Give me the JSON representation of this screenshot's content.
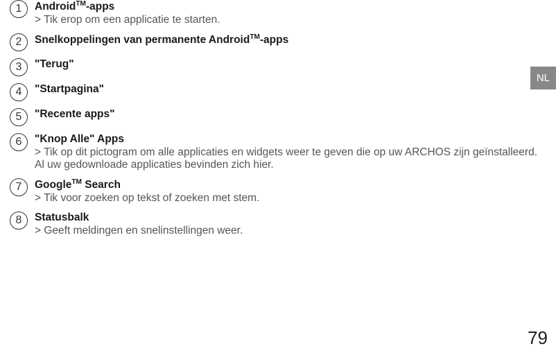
{
  "lang_tab": "NL",
  "page_number": "79",
  "items": [
    {
      "num": "1",
      "title_pre": "Android",
      "title_sup": "TM",
      "title_post": "-apps",
      "desc": "> Tik erop om een applicatie te starten."
    },
    {
      "num": "2",
      "title_pre": "Snelkoppelingen van permanente Android",
      "title_sup": "TM",
      "title_post": "-apps",
      "desc": ""
    },
    {
      "num": "3",
      "title_pre": "\"Terug\"",
      "title_sup": "",
      "title_post": "",
      "desc": ""
    },
    {
      "num": "4",
      "title_pre": "\"Startpagina\"",
      "title_sup": "",
      "title_post": "",
      "desc": ""
    },
    {
      "num": "5",
      "title_pre": "\"Recente apps\"",
      "title_sup": "",
      "title_post": "",
      "desc": ""
    },
    {
      "num": "6",
      "title_pre": "\"Knop Alle\" Apps",
      "title_sup": "",
      "title_post": "",
      "desc": "> Tik op dit pictogram om alle applicaties en widgets weer te geven die op uw ARCHOS zijn geïnstalleerd. Al uw gedownloade applicaties bevinden zich hier."
    },
    {
      "num": "7",
      "title_pre": "Google",
      "title_sup": "TM",
      "title_post": " Search",
      "desc": "> Tik voor zoeken op tekst of zoeken met stem."
    },
    {
      "num": "8",
      "title_pre": "Statusbalk",
      "title_sup": "",
      "title_post": "",
      "desc": "> Geeft meldingen en snelinstellingen weer."
    }
  ]
}
